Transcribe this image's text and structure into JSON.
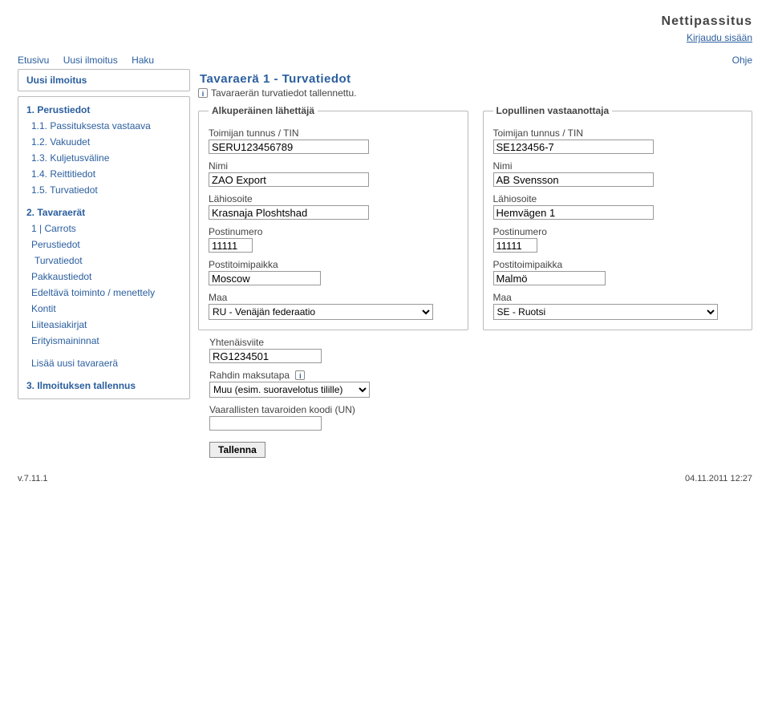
{
  "app_title": "Nettipassitus",
  "login_link": "Kirjaudu sisään",
  "nav": {
    "etusivu": "Etusivu",
    "uusi_ilmoitus": "Uusi ilmoitus",
    "haku": "Haku",
    "ohje": "Ohje"
  },
  "sidebar": {
    "box_title": "Uusi ilmoitus",
    "items": {
      "perustiedot_h": "1. Perustiedot",
      "passituksesta": "1.1. Passituksesta vastaava",
      "vakuudet": "1.2. Vakuudet",
      "kuljetusvaline": "1.3. Kuljetusväline",
      "reittitiedot": "1.4. Reittitiedot",
      "turvatiedot": "1.5. Turvatiedot",
      "tavaraerat_h": "2. Tavaraerät",
      "carrots": "1 | Carrots",
      "perustiedot": "Perustiedot",
      "turvatiedot2": "Turvatiedot",
      "pakkaustiedot": "Pakkaustiedot",
      "edeltava": "Edeltävä toiminto / menettely",
      "kontit": "Kontit",
      "liiteasiakirjat": "Liiteasiakirjat",
      "erityis": "Erityismaininnat",
      "lisaa": "Lisää uusi tavaraerä",
      "tallennus_h": "3. Ilmoituksen tallennus"
    }
  },
  "main": {
    "title": "Tavaraerä 1 - Turvatiedot",
    "info_msg": "Tavaraerän turvatiedot tallennettu.",
    "sender_legend": "Alkuperäinen lähettäjä",
    "recipient_legend": "Lopullinen vastaanottaja",
    "labels": {
      "tin": "Toimijan tunnus / TIN",
      "nimi": "Nimi",
      "lahiosoite": "Lähiosoite",
      "postinumero": "Postinumero",
      "postitoimipaikka": "Postitoimipaikka",
      "maa": "Maa",
      "yhtenaisviite": "Yhtenäisviite",
      "rahdin": "Rahdin maksutapa",
      "vaarallisten": "Vaarallisten tavaroiden koodi (UN)"
    },
    "sender": {
      "tin": "SERU123456789",
      "nimi": "ZAO Export",
      "lahiosoite": "Krasnaja Ploshtshad",
      "postinumero": "11111",
      "postitoimipaikka": "Moscow",
      "maa": "RU - Venäjän federaatio"
    },
    "recipient": {
      "tin": "SE123456-7",
      "nimi": "AB Svensson",
      "lahiosoite": "Hemvägen 1",
      "postinumero": "11111",
      "postitoimipaikka": "Malmö",
      "maa": "SE - Ruotsi"
    },
    "extra": {
      "yhtenaisviite": "RG1234501",
      "rahdin": "Muu (esim. suoravelotus tilille)",
      "vaarallisten": ""
    },
    "save_btn": "Tallenna"
  },
  "footer": {
    "version": "v.7.11.1",
    "timestamp": "04.11.2011 12:27"
  }
}
